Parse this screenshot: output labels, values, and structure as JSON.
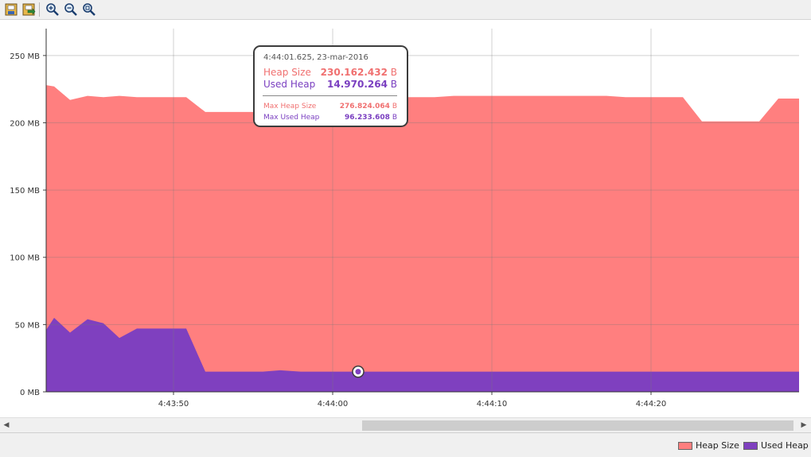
{
  "toolbar": {
    "buttons": [
      {
        "icon": "save-image-icon"
      },
      {
        "icon": "export-image-icon"
      },
      {
        "icon": "zoom-in-icon"
      },
      {
        "icon": "zoom-out-icon"
      },
      {
        "icon": "zoom-fit-icon"
      }
    ]
  },
  "tooltip": {
    "timestamp": "4:44:01.625, 23-mar-2016",
    "heap_size_label": "Heap Size",
    "heap_size_value": "230.162.432",
    "heap_size_unit": "B",
    "used_heap_label": "Used Heap",
    "used_heap_value": "14.970.264",
    "used_heap_unit": "B",
    "max_heap_size_label": "Max Heap Size",
    "max_heap_size_value": "276.824.064",
    "max_heap_size_unit": "B",
    "max_used_heap_label": "Max Used Heap",
    "max_used_heap_value": "96.233.608",
    "max_used_heap_unit": "B"
  },
  "legend": {
    "items": [
      {
        "label": "Heap Size",
        "color": "#ff7f7f"
      },
      {
        "label": "Used Heap",
        "color": "#7f40bf"
      }
    ]
  },
  "chart_data": {
    "type": "area",
    "x_unit": "seconds",
    "xlim": [
      "4:43:42.0",
      "4:44:29.3"
    ],
    "ylim": [
      0,
      270
    ],
    "y_unit": "MB",
    "yticks": [
      0,
      50,
      100,
      150,
      200,
      250
    ],
    "ytick_labels": [
      "0 MB",
      "50 MB",
      "100 MB",
      "150 MB",
      "200 MB",
      "250 MB"
    ],
    "xticks": [
      "4:43:50",
      "4:44:00",
      "4:44:10",
      "4:44:20"
    ],
    "grid": true,
    "legend_position": "bottom-right",
    "x": [
      "4:43:42.0",
      "4:43:42.5",
      "4:43:43.5",
      "4:43:44.6",
      "4:43:45.6",
      "4:43:46.6",
      "4:43:47.7",
      "4:43:48.7",
      "4:43:49.8",
      "4:43:50.8",
      "4:43:52.0",
      "4:43:53.3",
      "4:43:54.5",
      "4:43:55.6",
      "4:43:56.7",
      "4:43:58.0",
      "4:43:59.2",
      "4:44:00.4",
      "4:44:01.6",
      "4:44:02.8",
      "4:44:04.0",
      "4:44:05.2",
      "4:44:06.4",
      "4:44:07.6",
      "4:44:08.8",
      "4:44:10.0",
      "4:44:11.2",
      "4:44:12.4",
      "4:44:13.6",
      "4:44:14.8",
      "4:44:16.0",
      "4:44:17.2",
      "4:44:18.4",
      "4:44:19.6",
      "4:44:20.8",
      "4:44:22.0",
      "4:44:23.2",
      "4:44:24.4",
      "4:44:25.6",
      "4:44:26.8",
      "4:44:28.0",
      "4:44:29.3"
    ],
    "series": [
      {
        "name": "Heap Size",
        "color": "#ff7f7f",
        "values": [
          228,
          227,
          217,
          220,
          219,
          220,
          219,
          219,
          219,
          219,
          208,
          208,
          208,
          208,
          208,
          208,
          208,
          208,
          230,
          219,
          219,
          219,
          219,
          220,
          220,
          220,
          220,
          220,
          220,
          220,
          220,
          220,
          219,
          219,
          219,
          219,
          201,
          201,
          201,
          201,
          218,
          218
        ]
      },
      {
        "name": "Used Heap",
        "color": "#7f40bf",
        "values": [
          46,
          55,
          44,
          54,
          51,
          40,
          47,
          47,
          47,
          47,
          15,
          15,
          15,
          15,
          16,
          15,
          15,
          15,
          15,
          15,
          15,
          15,
          15,
          15,
          15,
          15,
          15,
          15,
          15,
          15,
          15,
          15,
          15,
          15,
          15,
          15,
          15,
          15,
          15,
          15,
          15,
          15
        ]
      }
    ],
    "highlighted_point": "4:44:01.6"
  }
}
